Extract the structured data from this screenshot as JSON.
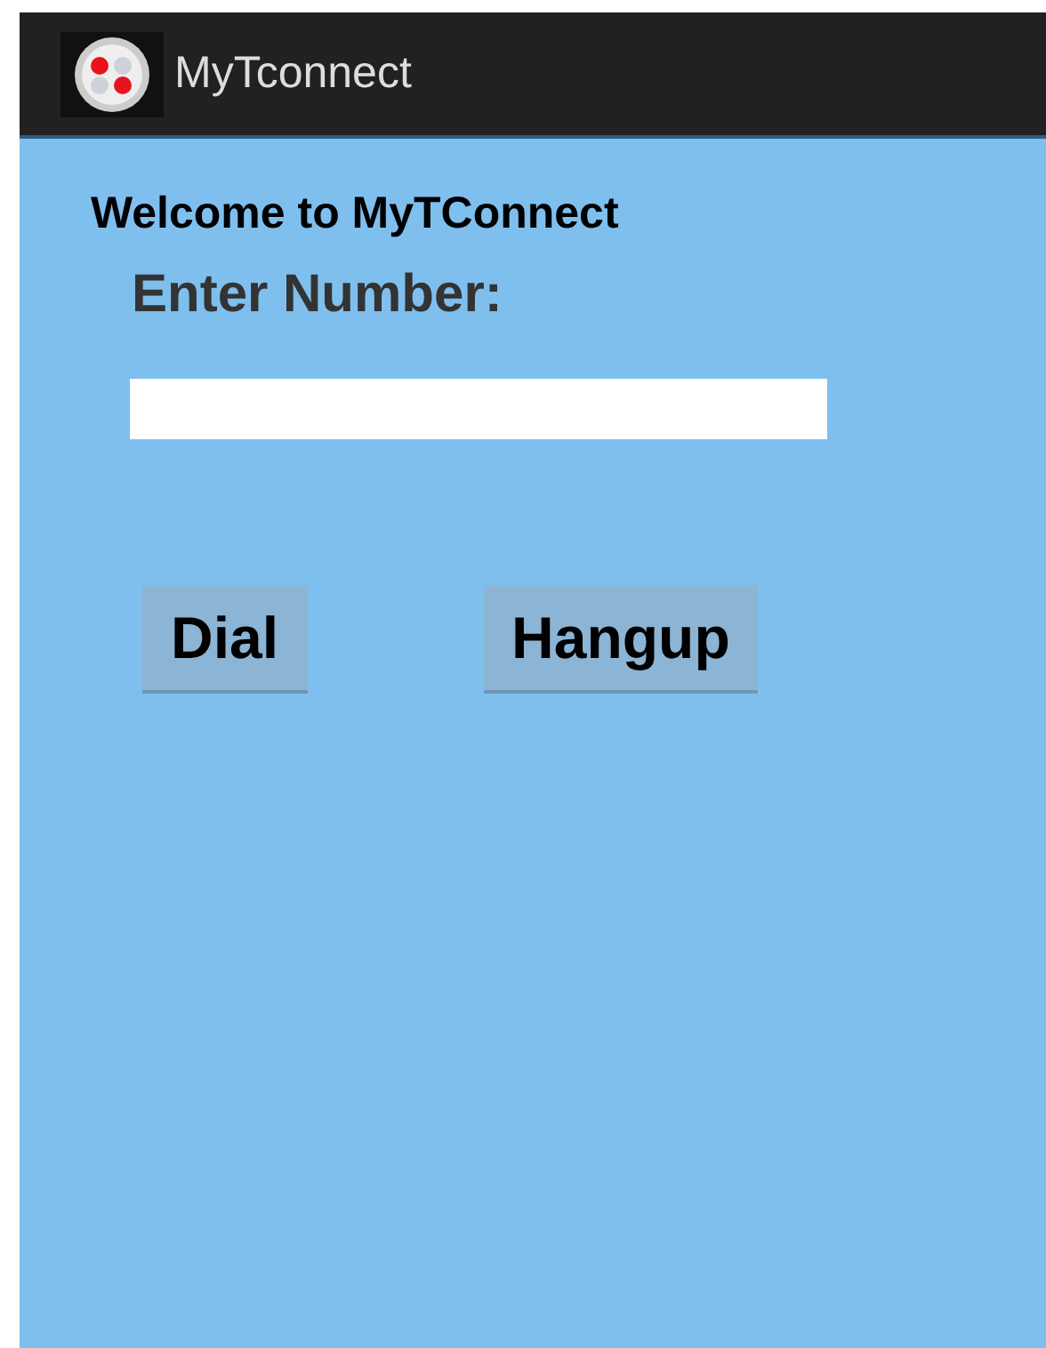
{
  "action_bar": {
    "title": "MyTconnect"
  },
  "welcome": "Welcome to MyTConnect",
  "number_label": "Enter Number:",
  "buttons": [
    {
      "label": "Dial"
    },
    {
      "label": "Hangup"
    }
  ]
}
